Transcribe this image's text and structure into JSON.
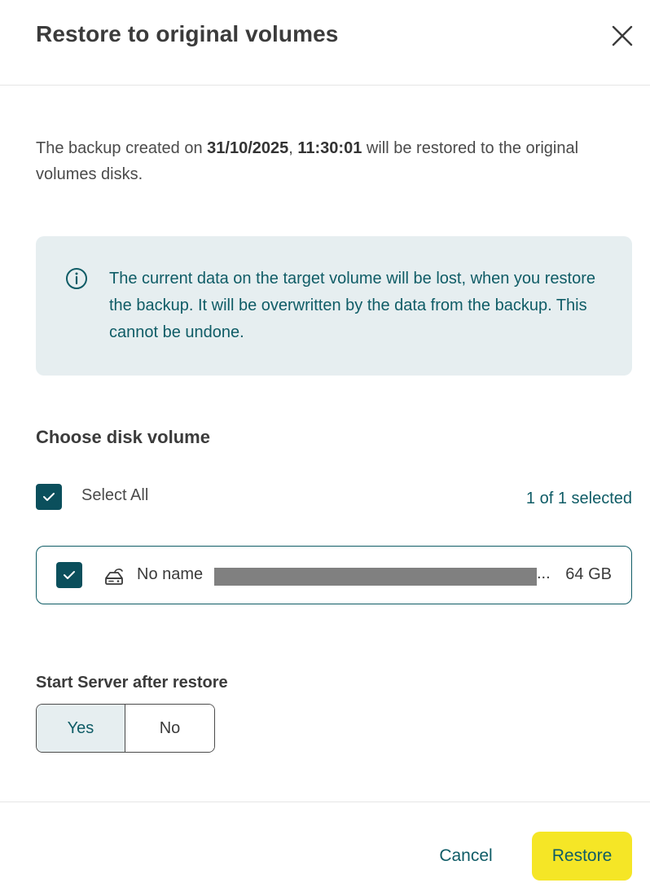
{
  "dialog": {
    "title": "Restore to original volumes",
    "close_icon": "close-icon"
  },
  "description": {
    "prefix": "The backup created on ",
    "date": "31/10/2025",
    "comma": ", ",
    "time": "11:30:01",
    "suffix": " will be restored to the original volumes disks."
  },
  "info": {
    "icon": "info-icon",
    "text": "The current data on the target volume will be lost, when you restore the backup. It will be overwritten by the data from the backup. This cannot be undone."
  },
  "volumes": {
    "section_title": "Choose disk volume",
    "select_all_label": "Select All",
    "select_all_checked": true,
    "selected_count": "1 of 1 selected",
    "items": [
      {
        "name": "No name",
        "ellipsis": "...",
        "size": "64 GB",
        "checked": true,
        "icon": "disk-icon"
      }
    ]
  },
  "start_server": {
    "label": "Start Server after restore",
    "options": [
      "Yes",
      "No"
    ],
    "selected": "Yes"
  },
  "footer": {
    "cancel_label": "Cancel",
    "restore_label": "Restore"
  },
  "colors": {
    "accent": "#0f5c66",
    "checkbox": "#0b4f5c",
    "info_bg": "#e6eef0",
    "primary_button": "#f5e626"
  }
}
